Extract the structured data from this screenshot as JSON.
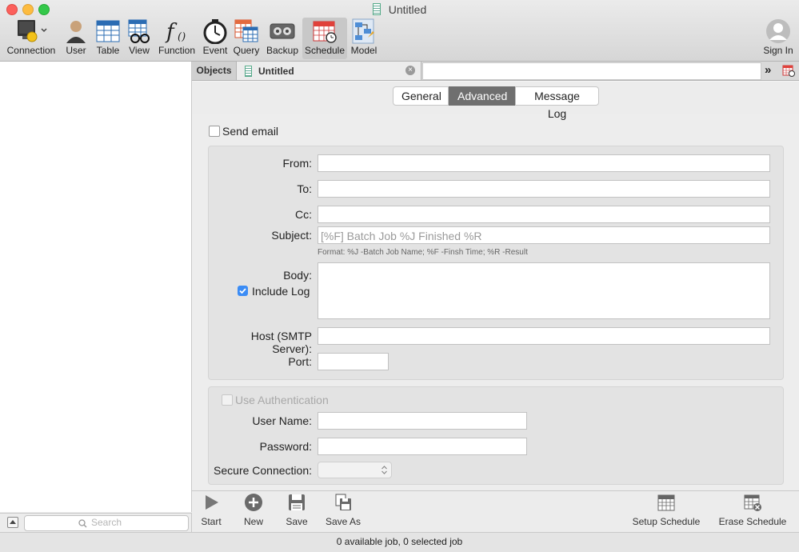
{
  "window": {
    "title": "Untitled"
  },
  "toolbar": {
    "items": [
      {
        "label": "Connection"
      },
      {
        "label": "User"
      },
      {
        "label": "Table"
      },
      {
        "label": "View"
      },
      {
        "label": "Function"
      },
      {
        "label": "Event"
      },
      {
        "label": "Query"
      },
      {
        "label": "Backup"
      },
      {
        "label": "Schedule"
      },
      {
        "label": "Model"
      }
    ],
    "sign_in": "Sign In"
  },
  "sidebar": {
    "search_placeholder": "Search"
  },
  "tabs": {
    "objects": "Objects",
    "doc": "Untitled"
  },
  "segments": {
    "general": "General",
    "advanced": "Advanced",
    "message_log": "Message Log",
    "selected": "Advanced"
  },
  "form": {
    "send_email": "Send email",
    "from_label": "From:",
    "to_label": "To:",
    "cc_label": "Cc:",
    "subject_label": "Subject:",
    "subject_placeholder": "[%F] Batch Job %J Finished %R",
    "subject_hint": "Format: %J -Batch Job Name; %F -Finsh Time; %R -Result",
    "body_label": "Body:",
    "include_log": "Include Log",
    "host_label": "Host (SMTP Server):",
    "port_label": "Port:",
    "use_auth": "Use Authentication",
    "username_label": "User Name:",
    "password_label": "Password:",
    "secure_label": "Secure Connection:"
  },
  "bottom_toolbar": {
    "start": "Start",
    "new": "New",
    "save": "Save",
    "save_as": "Save As",
    "setup_schedule": "Setup Schedule",
    "erase_schedule": "Erase Schedule"
  },
  "status": {
    "text": "0 available job, 0 selected job"
  },
  "colors": {
    "close": "#fc605c",
    "minimize": "#fdbc40",
    "zoom": "#34c84a",
    "accent": "#3b8cf5"
  }
}
